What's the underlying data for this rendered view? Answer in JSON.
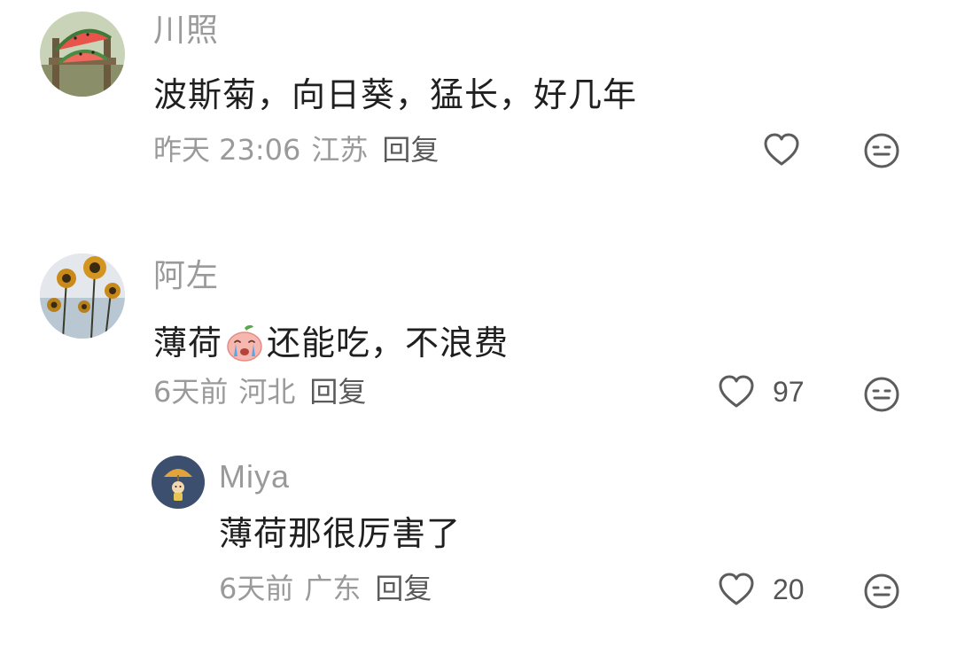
{
  "comments": [
    {
      "username": "川照",
      "content": "波斯菊，向日葵，猛长，好几年",
      "time": "昨天 23:06",
      "location": "江苏",
      "reply_label": "回复",
      "likes": "",
      "avatar_icon": "watermelon-avatar"
    },
    {
      "username": "阿左",
      "content_before": "薄荷",
      "content_emoji": "crying-peach-emoji",
      "content_after": "还能吃，不浪费",
      "time": "6天前",
      "location": "河北",
      "reply_label": "回复",
      "likes": "97",
      "avatar_icon": "sunflower-avatar"
    }
  ],
  "replies": [
    {
      "username": "Miya",
      "content": "薄荷那很厉害了",
      "time": "6天前",
      "location": "广东",
      "reply_label": "回复",
      "likes": "20",
      "avatar_icon": "cartoon-umbrella-avatar"
    }
  ],
  "colors": {
    "text_primary": "#1f1f1f",
    "text_secondary": "#9a9a9a",
    "icon_stroke": "#5c5c5c",
    "background": "#ffffff"
  }
}
